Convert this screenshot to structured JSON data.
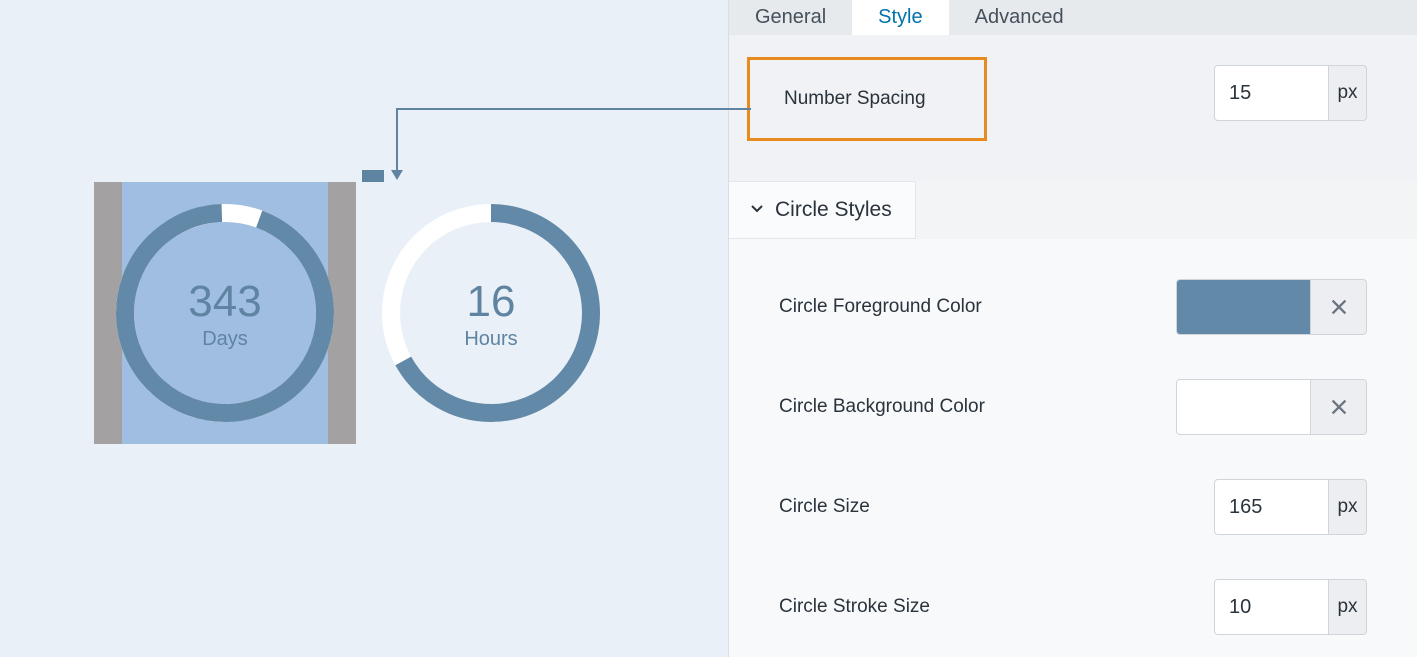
{
  "tabs": {
    "general": "General",
    "style": "Style",
    "advanced": "Advanced"
  },
  "top_option": {
    "label": "Number Spacing",
    "value": "15",
    "unit": "px"
  },
  "section": {
    "title": "Circle Styles"
  },
  "options": {
    "fg": {
      "label": "Circle Foreground Color",
      "value": "#6289a7"
    },
    "bg": {
      "label": "Circle Background Color",
      "value": "#ffffff"
    },
    "size": {
      "label": "Circle Size",
      "value": "165",
      "unit": "px"
    },
    "stroke": {
      "label": "Circle Stroke Size",
      "value": "10",
      "unit": "px"
    }
  },
  "preview": {
    "circle1": {
      "number": "343",
      "label": "Days",
      "progress": 0.94
    },
    "circle2": {
      "number": "16",
      "label": "Hours",
      "progress": 0.67
    }
  },
  "colors": {
    "ring": "#6289a7",
    "ring_bg": "#ffffff"
  }
}
